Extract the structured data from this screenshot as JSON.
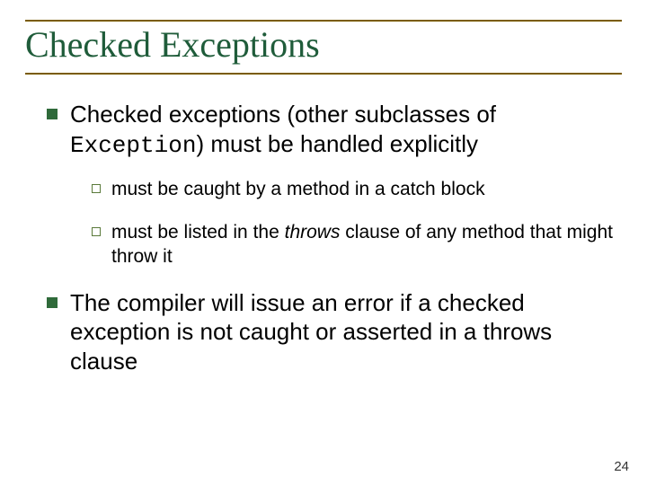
{
  "title": "Checked Exceptions",
  "bullets": [
    {
      "pre": "Checked exceptions (other subclasses of ",
      "code": "Exception",
      "post": ") must be handled explicitly",
      "sub": [
        {
          "text": "must be caught by a method in a catch block"
        },
        {
          "pre": "must be listed in the ",
          "em": "throws",
          "post": " clause of any method that might throw it"
        }
      ]
    },
    {
      "text": "The compiler will issue an error if a checked exception is not caught or asserted in a throws clause"
    }
  ],
  "page_number": "24"
}
